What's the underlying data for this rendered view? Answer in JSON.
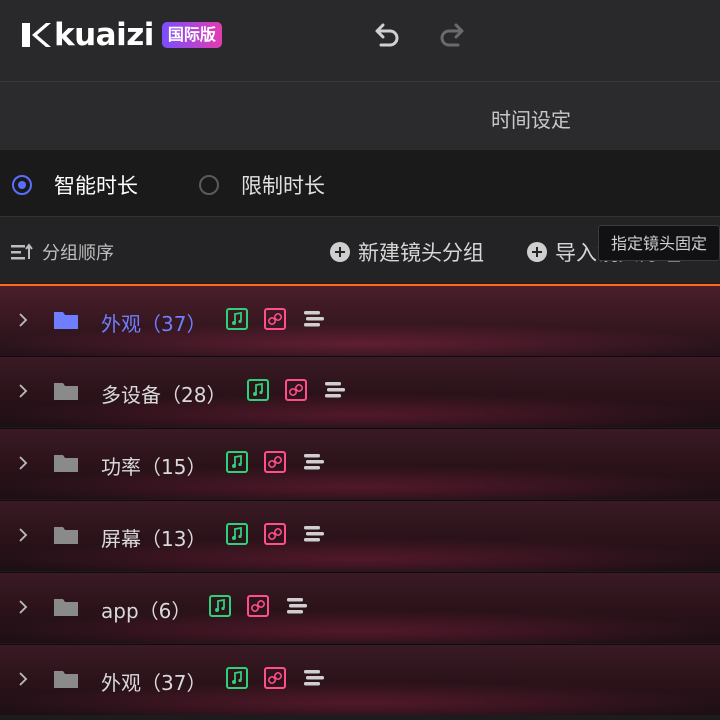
{
  "app": {
    "logo_text": "kuaizi",
    "logo_badge": "国际版"
  },
  "header": {
    "title": "时间设定"
  },
  "mode": {
    "options": [
      {
        "label": "智能时长",
        "selected": true
      },
      {
        "label": "限制时长",
        "selected": false
      }
    ]
  },
  "toolbar": {
    "sort_label": "分组顺序",
    "new_group_label": "新建镜头分组",
    "import_label": "导入镜头分组",
    "tooltip": "指定镜头固定"
  },
  "groups": [
    {
      "name": "外观（37）",
      "selected": true
    },
    {
      "name": "多设备（28）",
      "selected": false
    },
    {
      "name": "功率（15）",
      "selected": false
    },
    {
      "name": "屏幕（13）",
      "selected": false
    },
    {
      "name": "app（6）",
      "selected": false
    },
    {
      "name": "外观（37）",
      "selected": false
    }
  ],
  "colors": {
    "accent": "#5b6dff",
    "selection_border": "#ff6a1a",
    "music_badge": "#2fd07a",
    "link_badge": "#ff4d8d"
  },
  "icons": {
    "row_icons": [
      "chevron-right-icon",
      "folder-icon",
      "music-icon",
      "link-icon",
      "lines-icon"
    ]
  }
}
